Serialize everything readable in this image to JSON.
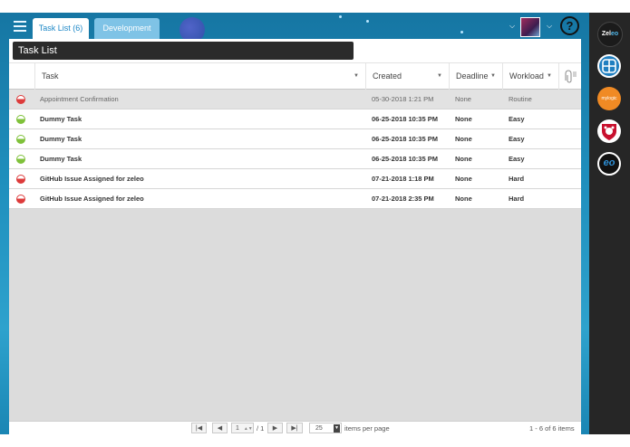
{
  "tabs": [
    {
      "label": "Task List (6)",
      "active": true
    },
    {
      "label": "Development",
      "active": false
    }
  ],
  "panel": {
    "title": "Task List"
  },
  "columns": {
    "task": "Task",
    "created": "Created",
    "deadline": "Deadline",
    "workload": "Workload"
  },
  "rows": [
    {
      "status": "red",
      "task": "Appointment Confirmation",
      "created": "05-30-2018 1:21 PM",
      "deadline": "None",
      "workload": "Routine"
    },
    {
      "status": "green",
      "task": "Dummy Task",
      "created": "06-25-2018 10:35 PM",
      "deadline": "None",
      "workload": "Easy"
    },
    {
      "status": "green",
      "task": "Dummy Task",
      "created": "06-25-2018 10:35 PM",
      "deadline": "None",
      "workload": "Easy"
    },
    {
      "status": "green",
      "task": "Dummy Task",
      "created": "06-25-2018 10:35 PM",
      "deadline": "None",
      "workload": "Easy"
    },
    {
      "status": "red",
      "task": "GitHub Issue Assigned for zeleo",
      "created": "07-21-2018 1:18 PM",
      "deadline": "None",
      "workload": "Hard"
    },
    {
      "status": "red",
      "task": "GitHub Issue Assigned for zeleo",
      "created": "07-21-2018 2:35 PM",
      "deadline": "None",
      "workload": "Hard"
    }
  ],
  "pager": {
    "page": "1",
    "total_pages": "/ 1",
    "page_size": "25",
    "items_per_page_label": "items per page",
    "summary": "1 - 6 of 6 items"
  },
  "sidebar": {
    "zeleo_logo_text": "Zeleo",
    "mylogic_text": "mylogic"
  },
  "colors": {
    "accent": "#1e88c7",
    "status_red": "#dd3b3b",
    "status_green": "#7fc13a",
    "sidebar_bg": "#262626"
  },
  "icons": [
    "menu-icon",
    "chevron-down-icon",
    "help-icon",
    "paperclip-icon",
    "first-page-icon",
    "prev-page-icon",
    "next-page-icon",
    "last-page-icon"
  ]
}
